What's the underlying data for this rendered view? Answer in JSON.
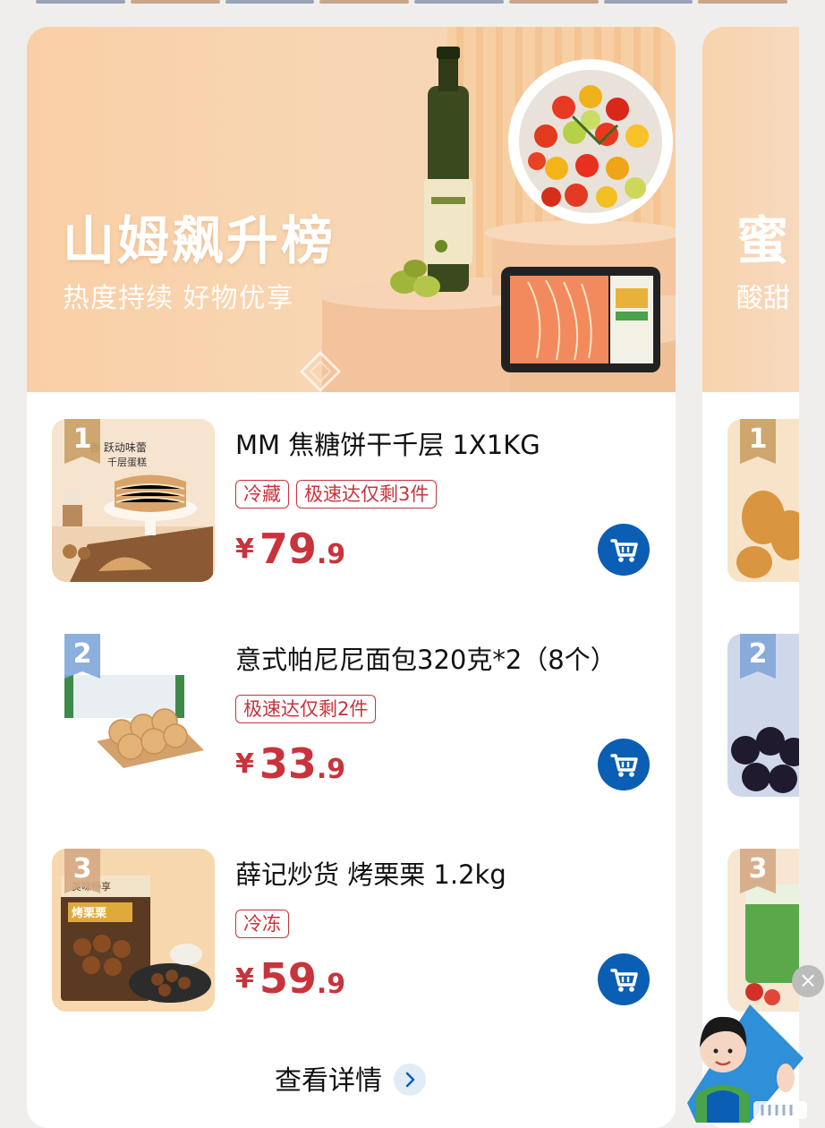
{
  "banner": {
    "title": "山姆飙升榜",
    "subtitle": "热度持续 好物优享"
  },
  "items": [
    {
      "rank": "1",
      "title": "MM 焦糖饼干千层 1X1KG",
      "tags": [
        "冷藏",
        "极速达仅剩3件"
      ],
      "currency": "¥",
      "price_int": "79",
      "price_dec": ".9",
      "thumb_text": "香 跃动味蕾 千层蛋糕"
    },
    {
      "rank": "2",
      "title": "意式帕尼尼面包320克*2（8个）",
      "tags": [
        "极速达仅剩2件"
      ],
      "currency": "¥",
      "price_int": "33",
      "price_dec": ".9"
    },
    {
      "rank": "3",
      "title": "薛记炒货 烤栗栗 1.2kg",
      "tags": [
        "冷冻"
      ],
      "currency": "¥",
      "price_int": "59",
      "price_dec": ".9",
      "thumb_text": "美味畅享 烤栗栗"
    }
  ],
  "more_label": "查看详情",
  "next_card": {
    "title": "蜜",
    "subtitle": "酸甜",
    "ranks": [
      "1",
      "2",
      "3"
    ]
  },
  "close_label": "×",
  "colors": {
    "accent_red": "#c8333c",
    "cart_blue": "#0a5fb4",
    "banner_peach": "#f9cfa6"
  },
  "icons": [
    "cart-icon",
    "chevron-right-icon",
    "close-icon"
  ]
}
